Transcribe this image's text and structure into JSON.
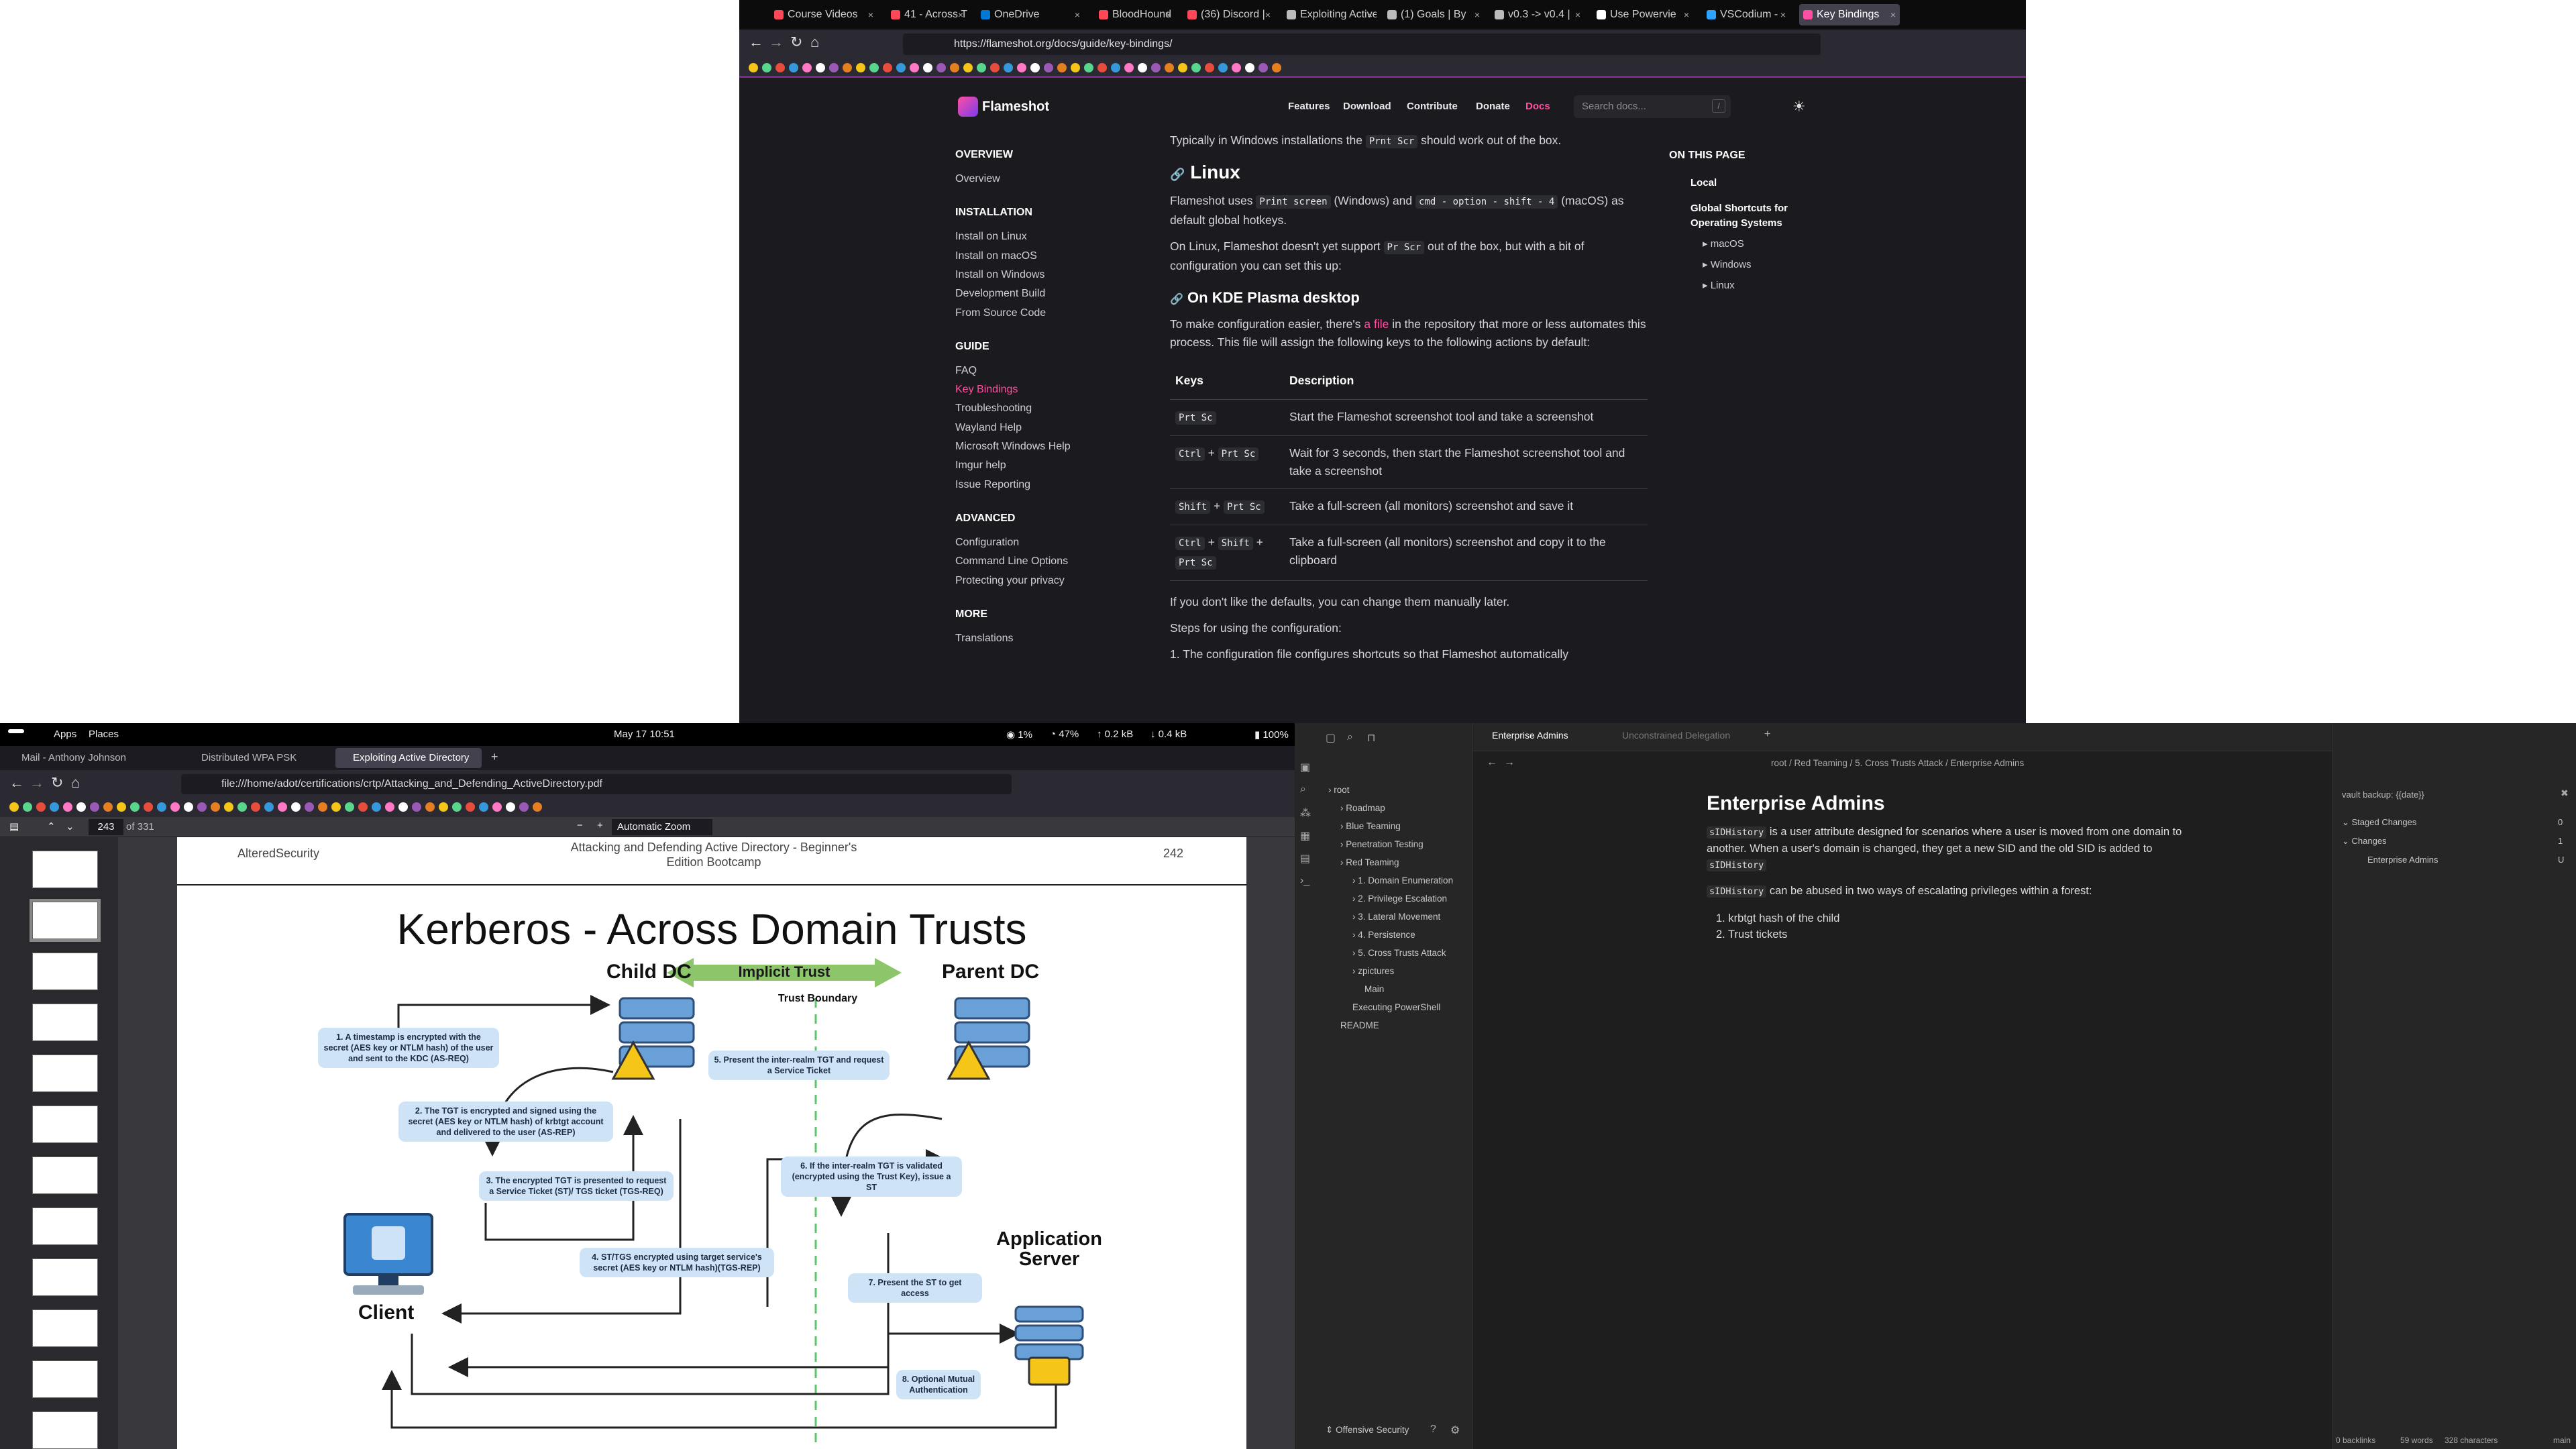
{
  "top_browser": {
    "tabs": [
      {
        "label": "Course Videos",
        "color": "#ff4757"
      },
      {
        "label": "41 - Across Tr",
        "color": "#ff4757"
      },
      {
        "label": "OneDrive",
        "color": "#0078d4"
      },
      {
        "label": "BloodHound",
        "color": "#ff4757"
      },
      {
        "label": "(36) Discord |",
        "color": "#ff4757"
      },
      {
        "label": "Exploiting Active",
        "color": "#bbbbbb"
      },
      {
        "label": "(1) Goals | By",
        "color": "#bbbbbb"
      },
      {
        "label": "v0.3 -> v0.4 |",
        "color": "#bbbbbb"
      },
      {
        "label": "Use Powervie",
        "color": "#ffffff"
      },
      {
        "label": "VSCodium -",
        "color": "#2ea2ff"
      },
      {
        "label": "Key Bindings",
        "color": "#ff4fa1"
      }
    ],
    "url": "https://flameshot.org/docs/guide/key-bindings/"
  },
  "flameshot": {
    "brand": "Flameshot",
    "nav": [
      "Features",
      "Download",
      "Contribute",
      "Donate",
      "Docs"
    ],
    "search_placeholder": "Search docs...",
    "search_key": "/",
    "sidebar": [
      {
        "heading": "OVERVIEW",
        "items": [
          "Overview"
        ]
      },
      {
        "heading": "INSTALLATION",
        "items": [
          "Install on Linux",
          "Install on macOS",
          "Install on Windows",
          "Development Build",
          "From Source Code"
        ]
      },
      {
        "heading": "GUIDE",
        "items": [
          "FAQ",
          "Key Bindings",
          "Troubleshooting",
          "Wayland Help",
          "Microsoft Windows Help",
          "Imgur help",
          "Issue Reporting"
        ]
      },
      {
        "heading": "ADVANCED",
        "items": [
          "Configuration",
          "Command Line Options",
          "Protecting your privacy"
        ]
      },
      {
        "heading": "MORE",
        "items": [
          "Translations"
        ]
      }
    ],
    "content": {
      "intro_pre": "Typically in Windows installations the",
      "intro_code": "Prnt Scr",
      "intro_post": "should work out of the box.",
      "h_linux": "Linux",
      "p1_pre": "Flameshot uses",
      "p1_code1": "Print screen",
      "p1_mid": "(Windows) and",
      "p1_code2": "cmd - option - shift - 4",
      "p1_post": "(macOS) as default global hotkeys.",
      "p2_pre": "On Linux, Flameshot doesn't yet support",
      "p2_code": "Pr Scr",
      "p2_post": "out of the box, but with a bit of configuration you can set this up:",
      "h_kde": "On KDE Plasma desktop",
      "p3_pre": "To make configuration easier, there's",
      "p3_link": "a file",
      "p3_post": "in the repository that more or less automates this process. This file will assign the following keys to the following actions by default:",
      "table_headers": [
        "Keys",
        "Description"
      ],
      "table_rows": [
        {
          "keys": "Prt Sc",
          "desc": "Start the Flameshot screenshot tool and take a screenshot"
        },
        {
          "keys": "Ctrl + Prt Sc",
          "desc": "Wait for 3 seconds, then start the Flameshot screenshot tool and take a screenshot"
        },
        {
          "keys": "Shift + Prt Sc",
          "desc": "Take a full-screen (all monitors) screenshot and save it"
        },
        {
          "keys": "Ctrl + Shift + Prt Sc",
          "desc": "Take a full-screen (all monitors) screenshot and copy it to the clipboard"
        }
      ],
      "p4": "If you don't like the defaults, you can change them manually later.",
      "p5": "Steps for using the configuration:",
      "p6": "1. The configuration file configures shortcuts so that Flameshot automatically"
    },
    "toc_heading": "ON THIS PAGE",
    "toc": [
      "Local",
      "Global Shortcuts for Operating Systems",
      "macOS",
      "Windows",
      "Linux"
    ]
  },
  "panel": {
    "apps": "Apps",
    "places": "Places",
    "clock": "May 17  10:51",
    "cpu": "1%",
    "mem": "47%",
    "net_up": "0.2 kB",
    "net_down": "0.4 kB",
    "battery": "100%"
  },
  "pdf_browser": {
    "tabs": [
      "Mail - Anthony Johnson",
      "Distributed WPA PSK",
      "Exploiting Active Directory"
    ],
    "url": "file:///home/adot/certifications/crtp/Attacking_and_Defending_ActiveDirectory.pdf",
    "page_current": "243",
    "page_total": "of 331",
    "zoom": "Automatic Zoom"
  },
  "slide": {
    "header_left": "AlteredSecurity",
    "header_center": "Attacking and Defending Active Directory - Beginner's Edition Bootcamp",
    "header_right": "242",
    "title": "Kerberos - Across Domain Trusts",
    "child_dc": "Child DC",
    "parent_dc": "Parent DC",
    "implicit_trust": "Implicit Trust",
    "trust_boundary": "Trust Boundary",
    "client": "Client",
    "app_server": "Application Server",
    "steps": [
      "1. A timestamp is encrypted with the secret (AES key or NTLM hash) of the user and sent to the KDC (AS-REQ)",
      "2. The TGT is encrypted and signed using the secret (AES key or NTLM hash) of  krbtgt account and delivered to the user (AS-REP)",
      "3. The encrypted TGT is presented to request a Service Ticket (ST)/ TGS ticket (TGS-REQ)",
      "4. ST/TGS encrypted using target service's secret (AES key or NTLM hash)(TGS-REP)",
      "5. Present the inter-realm TGT and request a Service Ticket",
      "6. If the inter-realm TGT is validated (encrypted using the Trust Key), issue a ST",
      "7. Present the ST to get access",
      "8. Optional Mutual Authentication"
    ]
  },
  "obsidian": {
    "tabs": [
      "Enterprise Admins",
      "Unconstrained Delegation"
    ],
    "breadcrumb": [
      "root",
      "Red Teaming",
      "5. Cross Trusts Attack",
      "Enterprise Admins"
    ],
    "tree": [
      {
        "label": "root",
        "level": 0
      },
      {
        "label": "Roadmap",
        "level": 1
      },
      {
        "label": "Blue Teaming",
        "level": 1
      },
      {
        "label": "Penetration Testing",
        "level": 1
      },
      {
        "label": "Red Teaming",
        "level": 1
      },
      {
        "label": "1. Domain Enumeration",
        "level": 2
      },
      {
        "label": "2. Privilege Escalation",
        "level": 2
      },
      {
        "label": "3. Lateral Movement",
        "level": 2
      },
      {
        "label": "4. Persistence",
        "level": 2
      },
      {
        "label": "5. Cross Trusts Attack",
        "level": 2
      },
      {
        "label": "zpictures",
        "level": 2
      },
      {
        "label": "Main",
        "level": 3
      },
      {
        "label": "Executing PowerShell",
        "level": 2
      },
      {
        "label": "README",
        "level": 1
      }
    ],
    "vault_name": "Offensive Security",
    "note_title": "Enterprise Admins",
    "note_p1_code": "sIDHistory",
    "note_p1": "is a user attribute designed for scenarios where a user is moved from one domain to another. When a user's domain is changed, they get a new SID and the old SID is added to",
    "note_p1_code2": "sIDHistory",
    "note_p2_code": "sIDHistory",
    "note_p2": "can be abused in two ways of escalating privileges within a forest:",
    "note_list": [
      "krbtgt hash of the child",
      "Trust tickets"
    ],
    "git_placeholder": "vault backup: {{date}}",
    "staged_label": "Staged Changes",
    "staged_count": "0",
    "changes_label": "Changes",
    "changes_count": "1",
    "changed_file": "Enterprise Admins",
    "changed_file_status": "U",
    "status_backlinks": "0 backlinks",
    "status_words": "59 words",
    "status_chars": "328 characters",
    "status_branch": "main"
  }
}
